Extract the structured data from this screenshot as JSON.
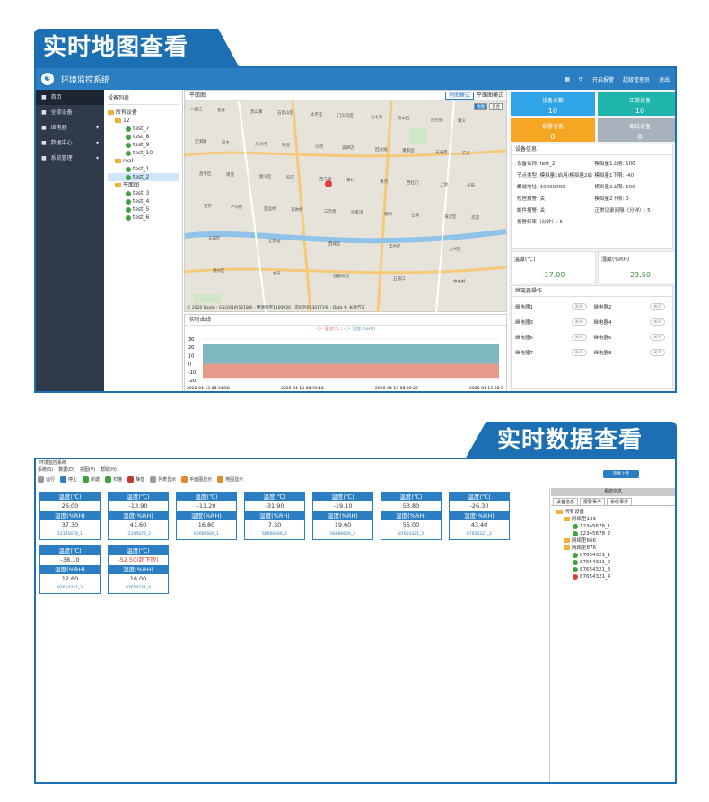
{
  "banners": {
    "map_view": "实时地图查看",
    "data_view": "实时数据查看"
  },
  "app1": {
    "title": "环境监控系统",
    "top_right": [
      "开启报警",
      "超级管理员",
      "退出"
    ],
    "sidebar": [
      {
        "label": "首页",
        "icon": "home-icon",
        "active": true
      },
      {
        "label": "全部设备",
        "icon": "devices-icon"
      },
      {
        "label": "继电器",
        "icon": "toggle-icon",
        "chevron": true
      },
      {
        "label": "数据中心",
        "icon": "data-icon",
        "chevron": true
      },
      {
        "label": "系统管理",
        "icon": "gear-icon",
        "chevron": true
      }
    ],
    "device_list": {
      "header": "设备列表",
      "root": "所有设备",
      "groups": [
        {
          "name": "12",
          "items": [
            "test_7",
            "test_8",
            "test_9",
            "test_10"
          ]
        },
        {
          "name": "real",
          "items": [
            "test_1",
            "test_2"
          ]
        },
        {
          "name": "平面图",
          "items": [
            "test_3",
            "test_4",
            "test_5",
            "test_6"
          ]
        }
      ]
    },
    "map": {
      "header": "平面图",
      "mode_map": "地图模式",
      "mode_plan": "平面图模式",
      "map_type_buttons": [
        "地图",
        "混合"
      ],
      "places": [
        "八里庄",
        "黑山寨",
        "太平庄",
        "北七家",
        "南召镇",
        "定泗路",
        "东沙河",
        "沙河",
        "回龙观",
        "天通苑",
        "昌平区",
        "顺义区",
        "西三旗",
        "清河",
        "上地",
        "望京",
        "亚运村",
        "三元桥",
        "朝阳",
        "海淀区",
        "东城区",
        "北京站",
        "西城区",
        "丰台区",
        "大兴区",
        "通州区",
        "亦庄",
        "首都机场",
        "五道口",
        "中关村",
        "鲁谷",
        "石景山区",
        "门头沟区",
        "房山区",
        "顺义",
        "良乡",
        "宋庄",
        "高碑店",
        "潘家园",
        "方庄",
        "南苑",
        "旧宫",
        "黄村",
        "西红门",
        "长阳",
        "卢沟桥",
        "马驹桥",
        "张家湾",
        "台湖",
        "次渠"
      ],
      "copyright": "© 2020 Baidu - GS(2019)5218号 - 甲测资字1100930 - 京ICP证030173号 - Data © 长地万方"
    },
    "curve": {
      "header": "实时曲线",
      "legend": [
        "温度(℃)",
        "湿度(%RH)"
      ],
      "y_ticks": [
        "30",
        "20",
        "10",
        "0",
        "-10",
        "-20"
      ],
      "x_ticks": [
        "2020-04-13 08:34:58",
        "2020-04-13 08:39:18",
        "2020-04-13 08:39:23",
        "2020-04-13 08:3"
      ]
    },
    "stats": [
      {
        "label": "设备总数",
        "value": "10",
        "color": "#2fa4e7"
      },
      {
        "label": "正常设备",
        "value": "10",
        "color": "#1fb5ac"
      },
      {
        "label": "报警设备",
        "value": "0",
        "color": "#f5a623"
      },
      {
        "label": "离线设备",
        "value": "0",
        "color": "#a9b2bc"
      }
    ],
    "device_info": {
      "header": "设备信息",
      "rows": [
        [
          "设备名称: test_2",
          "模拟量1上限: 100"
        ],
        [
          "节点类型: 模拟量1启用/模拟量2启用",
          "模拟量1下限: -40"
        ],
        [
          "终端地址: 10000000",
          "模拟量2上限: 100"
        ],
        [
          "短信报警: 关",
          "模拟量2下限: 0"
        ],
        [
          "邮件报警: 关",
          "正常记录间隔（分钟）: 5"
        ],
        [
          "报警频率（分钟）: 5",
          ""
        ]
      ]
    },
    "temp": {
      "label": "温度(℃)",
      "value": "-17.00"
    },
    "hum": {
      "label": "湿度(%RH)",
      "value": "23.50"
    },
    "relay": {
      "header": "继电器操作",
      "items": [
        "继电器1",
        "继电器2",
        "继电器3",
        "继电器4",
        "继电器5",
        "继电器6",
        "继电器7",
        "继电器8"
      ],
      "toggle_label": "关闭"
    }
  },
  "app2": {
    "window_title": "环境监控系统",
    "menu": [
      "系统(S)",
      "数据(D)",
      "视图(V)",
      "帮助(H)"
    ],
    "toolbar": [
      {
        "label": "运行",
        "icon": "play-icon",
        "cls": "gr"
      },
      {
        "label": "停止",
        "icon": "stop-icon",
        "cls": ""
      },
      {
        "label": "新建",
        "icon": "add-icon",
        "cls": "g"
      },
      {
        "label": "扫描",
        "icon": "scan-icon",
        "cls": "g"
      },
      {
        "label": "静音",
        "icon": "mute-icon",
        "cls": "r"
      },
      {
        "label": "列表显示",
        "icon": "list-icon",
        "cls": "gr"
      },
      {
        "label": "平面图显示",
        "icon": "plan-icon",
        "cls": "o"
      },
      {
        "label": "地图显示",
        "icon": "map-icon",
        "cls": "o"
      }
    ],
    "cloud_button": "连接上传",
    "temp_label": "温度(℃)",
    "hum_label": "湿度(%RH)",
    "cards": [
      {
        "temp": "26.00",
        "hum": "37.30",
        "id": "12345678_1",
        "alarm": false
      },
      {
        "temp": "-13.90",
        "hum": "41.60",
        "id": "12345678_2",
        "alarm": false
      },
      {
        "temp": "-11.20",
        "hum": "16.80",
        "id": "66666666_1",
        "alarm": false
      },
      {
        "temp": "-31.90",
        "hum": "7.30",
        "id": "66666666_2",
        "alarm": false
      },
      {
        "temp": "-19.10",
        "hum": "19.60",
        "id": "66666666_3",
        "alarm": false
      },
      {
        "temp": "53.80",
        "hum": "55.00",
        "id": "87654321_3",
        "alarm": false
      },
      {
        "temp": "-26.30",
        "hum": "43.40",
        "id": "87654321_2",
        "alarm": false
      },
      {
        "temp": "-38.10",
        "hum": "12.60",
        "id": "87654321_3",
        "alarm": false
      },
      {
        "temp": "-52.50(超下限)",
        "hum": "16.00",
        "id": "87654321_4",
        "alarm": true
      }
    ],
    "system_info": {
      "header": "系统信息",
      "tabs": [
        "设备信息",
        "报警事件",
        "系统事件"
      ],
      "root": "所有设备",
      "groups": [
        {
          "name": "网络型123",
          "items": [
            {
              "id": "12345678_1",
              "alarm": false
            },
            {
              "id": "12345678_2",
              "alarm": false
            }
          ]
        },
        {
          "name": "网络型666",
          "items": []
        },
        {
          "name": "网络型876",
          "items": [
            {
              "id": "87654321_1",
              "alarm": false
            },
            {
              "id": "87654321_2",
              "alarm": false
            },
            {
              "id": "87654321_3",
              "alarm": false
            },
            {
              "id": "87654321_4",
              "alarm": true
            }
          ]
        }
      ]
    }
  }
}
